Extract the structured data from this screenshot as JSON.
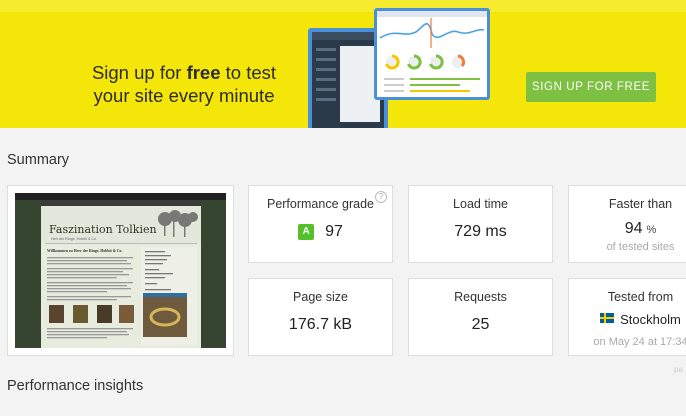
{
  "banner": {
    "line1_pre": "Sign up for ",
    "line1_bold": "free",
    "line1_post": " to test",
    "line2": "your site every minute",
    "cta_label": "SIGN UP FOR FREE"
  },
  "summary": {
    "title": "Summary",
    "performance_grade": {
      "label": "Performance grade",
      "grade": "A",
      "score": "97",
      "help": "?"
    },
    "load_time": {
      "label": "Load time",
      "value": "729 ms"
    },
    "faster_than": {
      "label": "Faster than",
      "value": "94",
      "unit": "%",
      "sub": "of tested sites"
    },
    "page_size": {
      "label": "Page size",
      "value": "176.7 kB"
    },
    "requests": {
      "label": "Requests",
      "value": "25"
    },
    "tested_from": {
      "label": "Tested from",
      "location": "Stockholm",
      "date": "on May 24 at 17:34"
    }
  },
  "thumbnail": {
    "site_title": "Faszination Tolkien",
    "site_subtitle": "Herr der Ringe, Hobbit & Co.",
    "nav": [
      "Startseite",
      "Herr der Ringe",
      "Der Hobbit",
      "Die Tolkien",
      "Tolkienwelt",
      "Filme",
      "Forum"
    ],
    "heading": "Willkommen zu Herr der Ringe, Hobbit & Co."
  },
  "insights": {
    "title": "Performance insights"
  },
  "colors": {
    "banner": "#f5e60a",
    "cta": "#7dc042",
    "grade": "#55c12a",
    "laptop": "#4a90d9"
  }
}
